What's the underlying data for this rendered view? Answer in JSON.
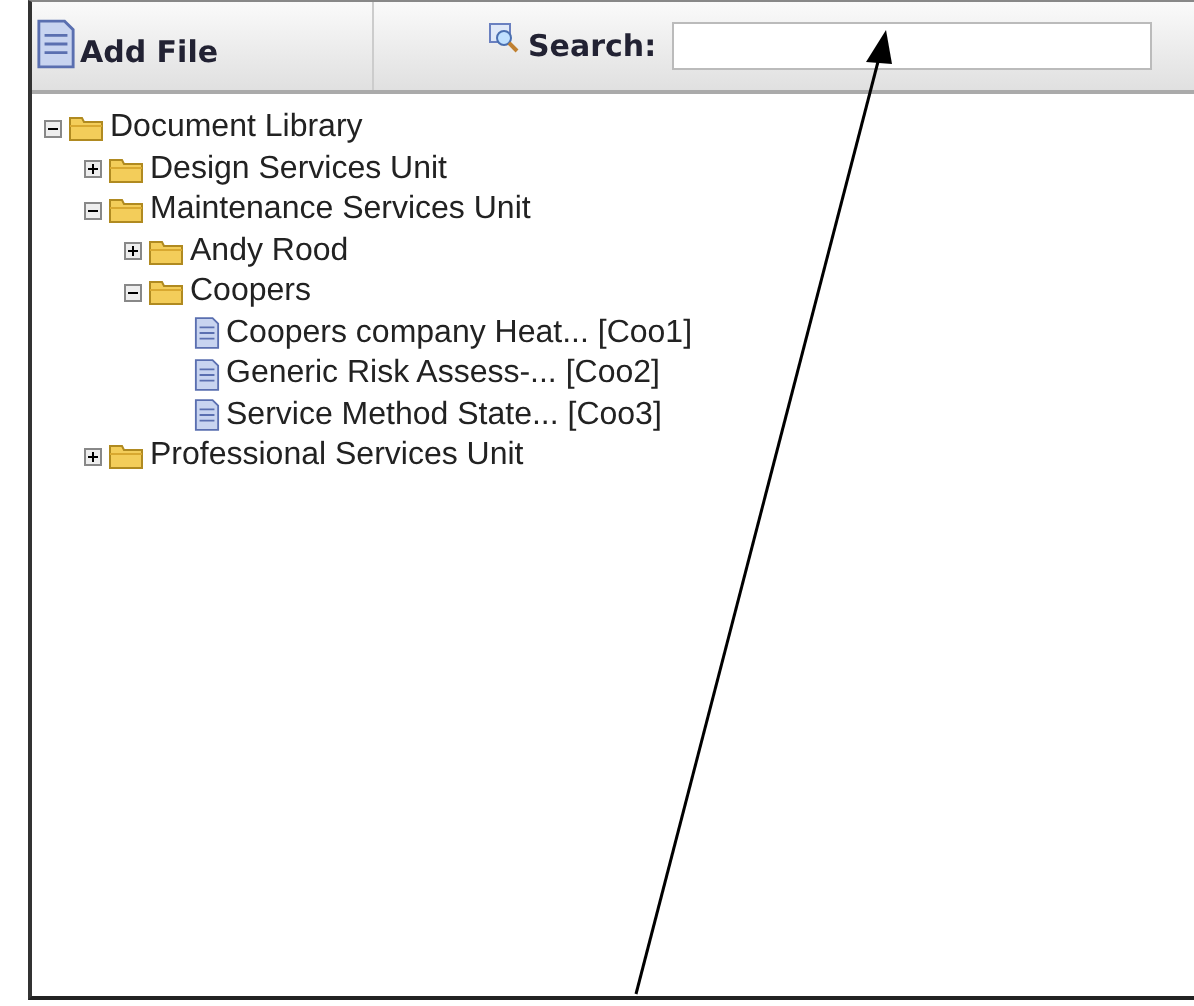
{
  "toolbar": {
    "add_button": "Add File",
    "search_label": "Search:"
  },
  "tree": [
    {
      "kind": "folder",
      "label": "Document Library",
      "expanded": true,
      "children": [
        {
          "kind": "folder",
          "label": "Design Services Unit",
          "expanded": false
        },
        {
          "kind": "folder",
          "label": "Maintenance Services Unit",
          "expanded": true,
          "children": [
            {
              "kind": "folder",
              "label": "Andy Rood",
              "expanded": false
            },
            {
              "kind": "folder",
              "label": "Coopers",
              "expanded": true,
              "children": [
                {
                  "kind": "file",
                  "label": "Coopers company Heat... [Coo1]"
                },
                {
                  "kind": "file",
                  "label": "Generic Risk Assess-... [Coo2]"
                },
                {
                  "kind": "file",
                  "label": "Service Method State... [Coo3]"
                }
              ]
            }
          ]
        },
        {
          "kind": "folder",
          "label": "Professional Services Unit",
          "expanded": false
        }
      ]
    }
  ]
}
